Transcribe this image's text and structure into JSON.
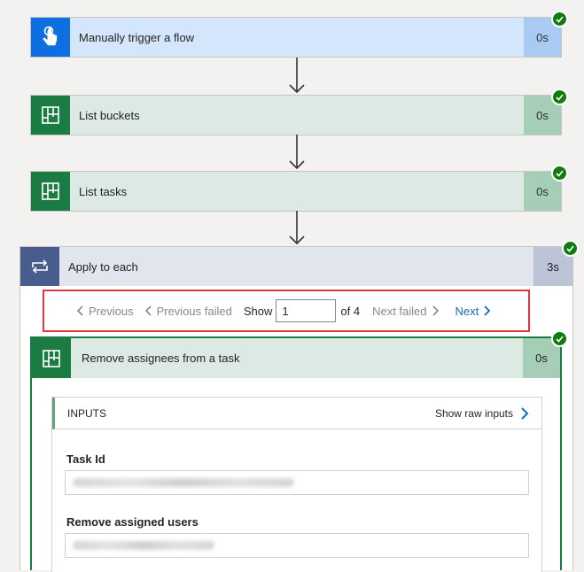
{
  "steps": [
    {
      "title": "Manually trigger a flow",
      "duration": "0s",
      "icon": "touch-hand-icon"
    },
    {
      "title": "List buckets",
      "duration": "0s",
      "icon": "planner-icon"
    },
    {
      "title": "List tasks",
      "duration": "0s",
      "icon": "planner-icon"
    }
  ],
  "apply_each": {
    "title": "Apply to each",
    "duration": "3s",
    "icon": "loop-icon"
  },
  "pager": {
    "previous": "Previous",
    "previous_failed": "Previous failed",
    "show": "Show",
    "current_value": "1",
    "of_total": "of 4",
    "next_failed": "Next failed",
    "next": "Next"
  },
  "remove_step": {
    "title": "Remove assignees from a task",
    "duration": "0s",
    "inputs_label": "INPUTS",
    "show_raw": "Show raw inputs",
    "fields": [
      {
        "label": "Task Id"
      },
      {
        "label": "Remove assigned users"
      }
    ]
  },
  "colors": {
    "success": "#107c10",
    "highlight_border": "#e0383e",
    "link": "#0f6cbd",
    "planner": "#1b7c43",
    "trigger": "#0d6fe0",
    "loop": "#485c8e"
  }
}
